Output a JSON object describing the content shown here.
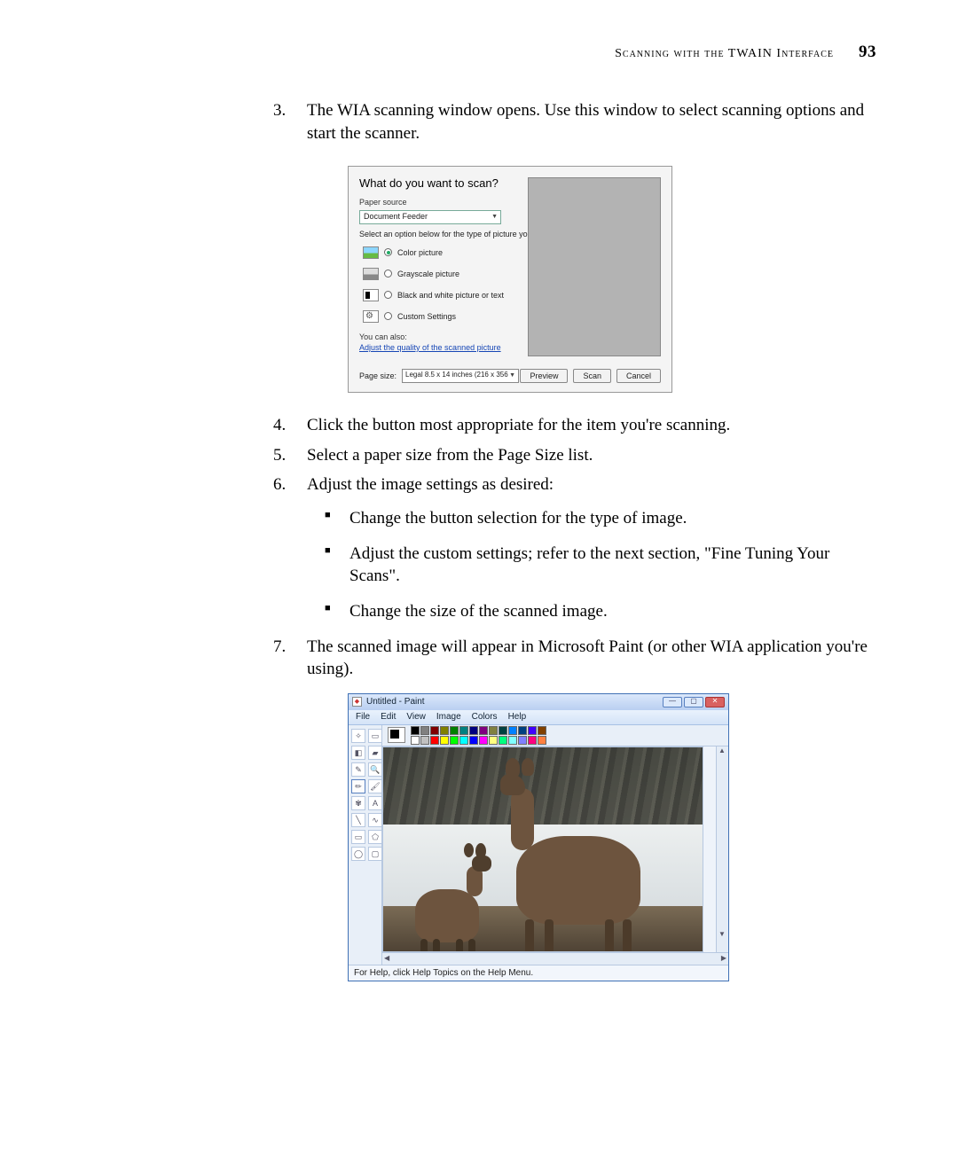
{
  "header": {
    "chapter": "Scanning with the TWAIN Interface",
    "page_number": "93"
  },
  "steps": {
    "s3": "The WIA scanning window opens. Use this window to select scanning options and start the scanner.",
    "s4": "Click the button most appropriate for the item you're scanning.",
    "s5": "Select a paper size from the Page Size list.",
    "s6": "Adjust the image settings as desired:",
    "s6_b1": "Change the button selection for the type of image.",
    "s6_b2": "Adjust the custom settings; refer to the next section, \"Fine Tuning Your Scans\".",
    "s6_b3": "Change the size of the scanned image.",
    "s7": "The scanned image will appear in Microsoft Paint (or other WIA application you're using)."
  },
  "wia": {
    "title": "What do you want to scan?",
    "paper_source_label": "Paper source",
    "paper_source_value": "Document Feeder",
    "hint": "Select an option below for the type of picture you want to scan.",
    "opt_color": "Color picture",
    "opt_gray": "Grayscale picture",
    "opt_bw": "Black and white picture or text",
    "opt_custom": "Custom Settings",
    "you_can_also": "You can also:",
    "adjust_link": "Adjust the quality of the scanned picture",
    "page_size_label": "Page size:",
    "page_size_value": "Legal 8.5 x 14 inches (216 x 356 ",
    "btn_preview": "Preview",
    "btn_scan": "Scan",
    "btn_cancel": "Cancel"
  },
  "paint": {
    "title": "Untitled - Paint",
    "menu": {
      "file": "File",
      "edit": "Edit",
      "view": "View",
      "image": "Image",
      "colors": "Colors",
      "help": "Help"
    },
    "palette_colors_row1": [
      "#000",
      "#808080",
      "#800000",
      "#808000",
      "#008000",
      "#008080",
      "#000080",
      "#800080",
      "#808040",
      "#004040",
      "#0080ff",
      "#004080",
      "#4000ff",
      "#804000"
    ],
    "palette_colors_row2": [
      "#fff",
      "#c0c0c0",
      "#ff0000",
      "#ffff00",
      "#00ff00",
      "#00ffff",
      "#0000ff",
      "#ff00ff",
      "#ffff80",
      "#00ff80",
      "#80ffff",
      "#8080ff",
      "#ff0080",
      "#ff8040"
    ],
    "status": "For Help, click Help Topics on the Help Menu."
  }
}
